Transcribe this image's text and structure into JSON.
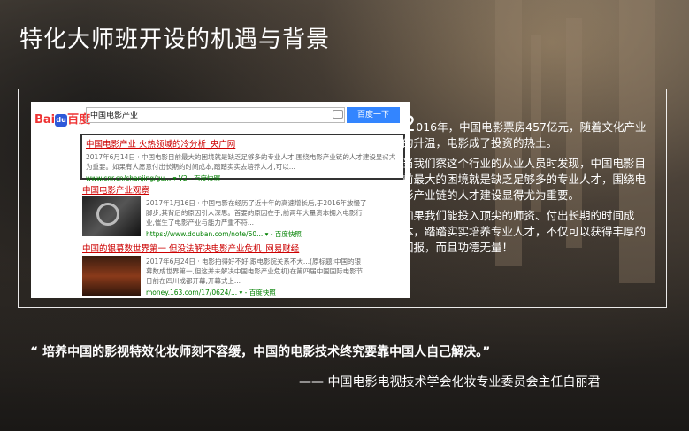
{
  "slide": {
    "title": "特化大师班开设的机遇与背景"
  },
  "screenshot": {
    "logo_text": "Bai",
    "logo_du": "du",
    "logo_suffix": "百度",
    "search_value": "中国电影产业",
    "search_button": "百度一下",
    "results": [
      {
        "title": "中国电影产业 火热领域的冷分析_央广网",
        "desc": "2017年6月14日 · 中国电影目前最大的困境就是缺乏足够多的专业人才,围绕电影产业链的人才建设显得尤为重要。如果有人愿意付出长期的时间成本,踏踏实实去培养人才,可以...",
        "url": "www.cnr.cn/chanjing/gu... ▾ V2 - 百度快照"
      },
      {
        "title": "中国电影产业观察",
        "desc": "2017年1月16日 · 中国电影在经历了近十年的高速增长后,于2016年放慢了脚步,其背后的原因引人深思。首要的原因在于,前两年大量资本拥入电影行业,催生了电影产业与能力严重不符...",
        "url": "https://www.douban.com/note/60... ▾ - 百度快照"
      },
      {
        "title": "中国的银幕数世界第一 但没法解决电影产业危机_网易财经",
        "desc": "2017年6月24日 · 电影拍得好不好,跟电影院关系不大...(原标题:中国的银幕数成世界第一,但这并未解决中国电影产业危机)在第四届中国国际电影节日前在四川成都开幕,开幕式上...",
        "url": "money.163.com/17/0624/... ▾ - 百度快照"
      }
    ]
  },
  "body_text": {
    "first_letter": "2",
    "paragraph1_rest": "016年，中国电影票房457亿元，随着文化产业的升温，电影成了投资的热土。",
    "paragraph2": "当我们察这个行业的从业人员时发现，中国电影目前最大的困境就是缺乏足够多的专业人才，围绕电影产业链的人才建设显得尤为重要。",
    "paragraph3": "如果我们能投入顶尖的师资、付出长期的时间成本，踏踏实实培养专业人才，不仅可以获得丰厚的回报，而且功德无量！"
  },
  "quote": {
    "text": "“ 培养中国的影视特效化妆师刻不容缓，中国的电影技术终究要靠中国人自己解决。”",
    "attribution": "—— 中国电影电视技术学会化妆专业委员会主任白丽君"
  },
  "colors": {
    "baidu_red": "#e33333",
    "baidu_blue": "#3385ff",
    "link_red": "#cc0000",
    "url_green": "#008000"
  }
}
